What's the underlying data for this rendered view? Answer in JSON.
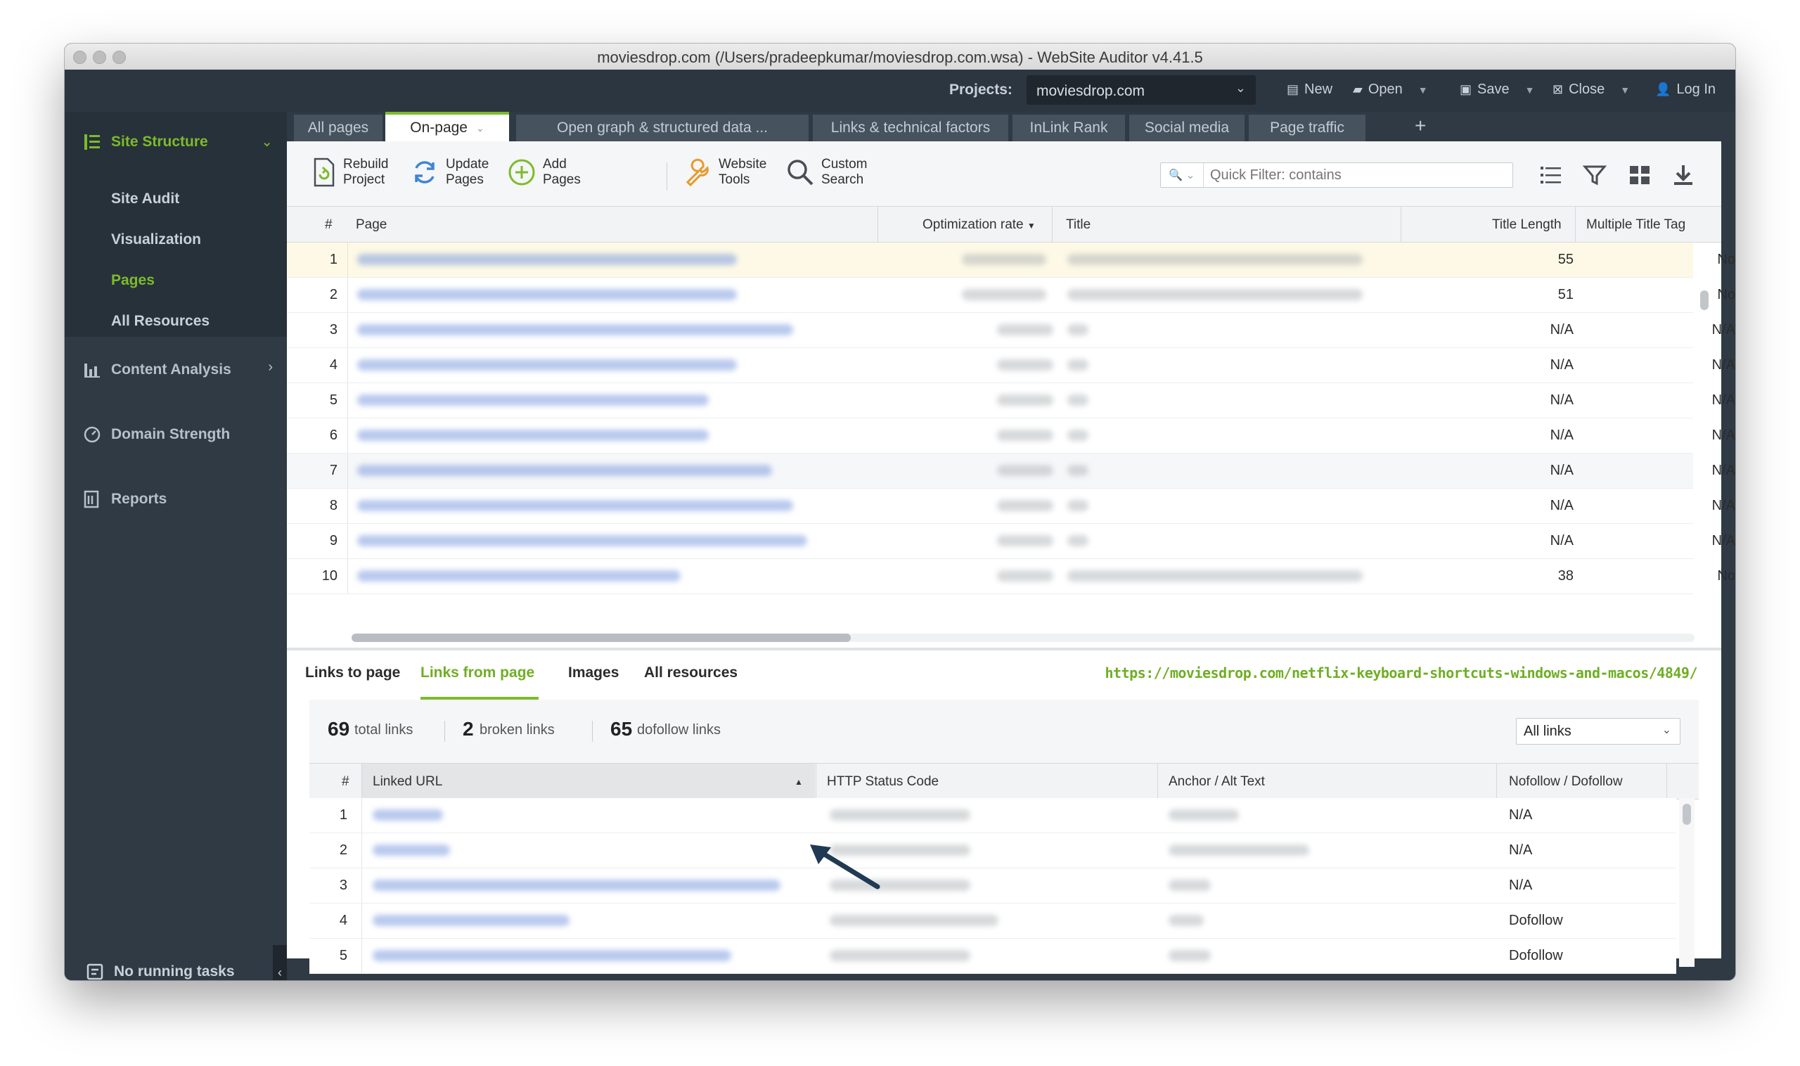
{
  "window": {
    "title": "moviesdrop.com (/Users/pradeepkumar/moviesdrop.com.wsa) - WebSite Auditor v4.41.5"
  },
  "topbar": {
    "projects_label": "Projects:",
    "project_value": "moviesdrop.com",
    "actions": [
      {
        "label": "New"
      },
      {
        "label": "Open"
      },
      {
        "label": "Save"
      },
      {
        "label": "Close"
      },
      {
        "label": "Log In"
      }
    ]
  },
  "sidebar": {
    "site_structure": "Site Structure",
    "sub_items": [
      "Site Audit",
      "Visualization",
      "Pages",
      "All Resources"
    ],
    "content_analysis": "Content Analysis",
    "domain_strength": "Domain Strength",
    "reports": "Reports",
    "tasks": "No running tasks"
  },
  "tabs": [
    "All pages",
    "On-page",
    "Open graph & structured data ...",
    "Links & technical factors",
    "InLink Rank",
    "Social media",
    "Page traffic"
  ],
  "toolbar": {
    "rebuild": [
      "Rebuild",
      "Project"
    ],
    "update": [
      "Update",
      "Pages"
    ],
    "add": [
      "Add",
      "Pages"
    ],
    "website_tools": [
      "Website",
      "Tools"
    ],
    "custom_search": [
      "Custom",
      "Search"
    ],
    "quick_filter_placeholder": "Quick Filter: contains"
  },
  "pages_table": {
    "columns": [
      "#",
      "Page",
      "Optimization rate",
      "Title",
      "Title Length",
      "Multiple Title Tag"
    ],
    "rows": [
      {
        "n": "1",
        "len": "55",
        "multi": "No"
      },
      {
        "n": "2",
        "len": "51",
        "multi": "No"
      },
      {
        "n": "3",
        "len": "N/A",
        "multi": "N/A"
      },
      {
        "n": "4",
        "len": "N/A",
        "multi": "N/A"
      },
      {
        "n": "5",
        "len": "N/A",
        "multi": "N/A"
      },
      {
        "n": "6",
        "len": "N/A",
        "multi": "N/A"
      },
      {
        "n": "7",
        "len": "N/A",
        "multi": "N/A"
      },
      {
        "n": "8",
        "len": "N/A",
        "multi": "N/A"
      },
      {
        "n": "9",
        "len": "N/A",
        "multi": "N/A"
      },
      {
        "n": "10",
        "len": "38",
        "multi": "No"
      }
    ]
  },
  "bottom": {
    "subtabs": [
      "Links to page",
      "Links from page",
      "Images",
      "All resources"
    ],
    "url": "https://moviesdrop.com/netflix-keyboard-shortcuts-windows-and-macos/4849/",
    "stats": [
      {
        "n": "69",
        "label": "total links"
      },
      {
        "n": "2",
        "label": "broken links"
      },
      {
        "n": "65",
        "label": "dofollow links"
      }
    ],
    "filter": "All links",
    "columns": [
      "#",
      "Linked URL",
      "HTTP Status Code",
      "Anchor / Alt Text",
      "Nofollow / Dofollow"
    ],
    "rows": [
      {
        "n": "1",
        "follow": "N/A"
      },
      {
        "n": "2",
        "follow": "N/A"
      },
      {
        "n": "3",
        "follow": "N/A"
      },
      {
        "n": "4",
        "follow": "Dofollow"
      },
      {
        "n": "5",
        "follow": "Dofollow"
      }
    ]
  },
  "colors": {
    "accent": "#7dbb2b",
    "sidebar": "#2f3a45",
    "link_blue": "#3a6fd8"
  }
}
